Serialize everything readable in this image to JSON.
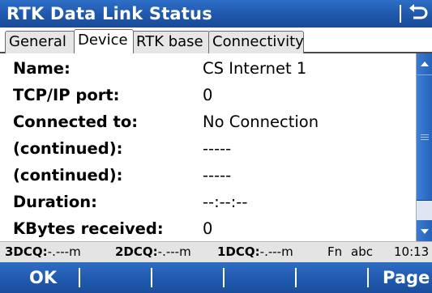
{
  "window": {
    "title": "RTK Data Link Status",
    "back_icon": "back-arrow-icon"
  },
  "tabs": [
    {
      "label": "General",
      "active": false
    },
    {
      "label": "Device",
      "active": true
    },
    {
      "label": "RTK base",
      "active": false
    },
    {
      "label": "Connectivity",
      "active": false
    }
  ],
  "fields": [
    {
      "label": "Name:",
      "value": "CS Internet 1"
    },
    {
      "label": "TCP/IP port:",
      "value": "0"
    },
    {
      "label": "Connected to:",
      "value": "No Connection"
    },
    {
      "label": "(continued):",
      "value": "-----"
    },
    {
      "label": "(continued):",
      "value": "-----"
    },
    {
      "label": "Duration:",
      "value": "--:--:--"
    },
    {
      "label": "KBytes received:",
      "value": "0"
    }
  ],
  "status_bar": {
    "dcq3_label": "3DCQ:",
    "dcq3_value": "-.---m",
    "dcq2_label": "2DCQ:",
    "dcq2_value": "-.---m",
    "dcq1_label": "1DCQ:",
    "dcq1_value": "-.---m",
    "fn": "Fn",
    "input_mode": "abc",
    "time": "10:13"
  },
  "softkeys": {
    "ok": "OK",
    "page": "Page"
  },
  "colors": {
    "titlebar": "#1f57ab",
    "softkeys": "#1f58ad",
    "scrollbar_thumb": "#2562ba"
  }
}
